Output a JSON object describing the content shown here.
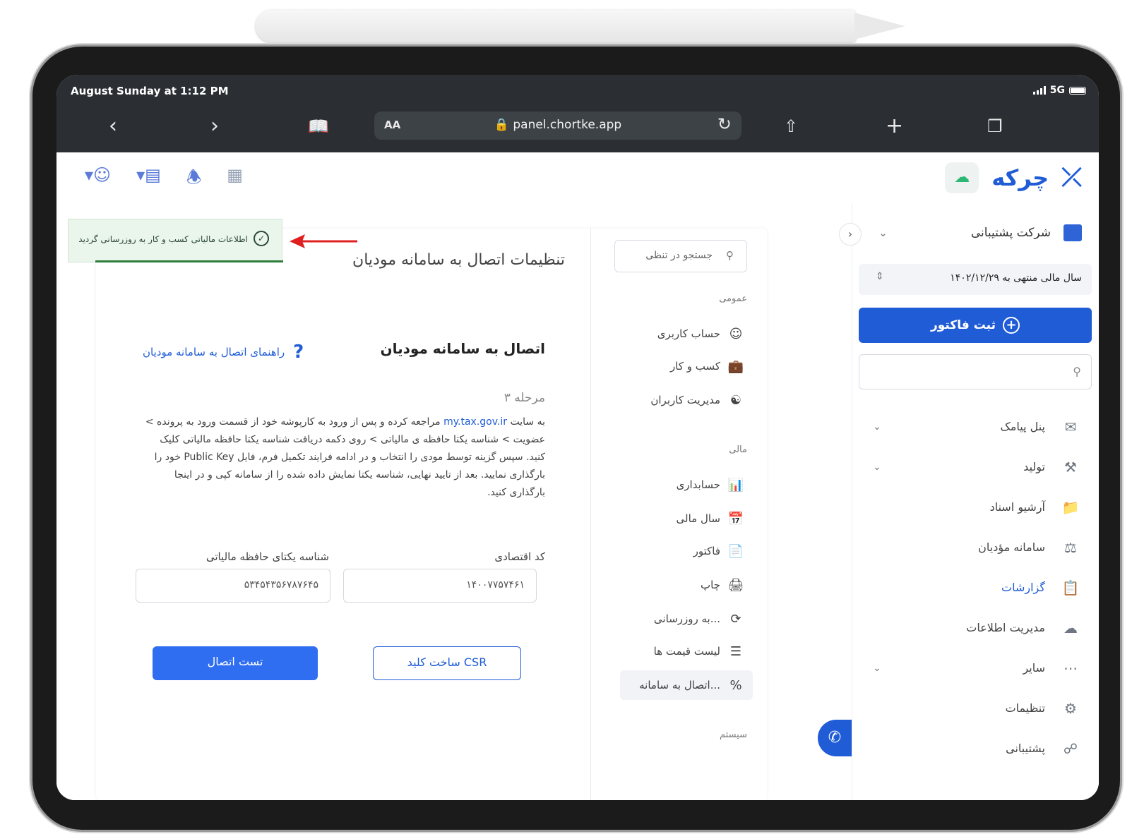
{
  "browser": {
    "status_time": "August Sunday at 1:12 PM",
    "network": "5G",
    "url_aa": "AA",
    "url": "panel.chortke.app"
  },
  "app": {
    "brand": "چرکه",
    "brand_color": "#1f5cd6"
  },
  "sidebar": {
    "company": "شرکت پشتیبانی",
    "fiscal_year": "سال مالی منتهی به ۱۴۰۲/۱۲/۲۹",
    "invoice_button": "ثبت فاکتور",
    "items": [
      {
        "label": "پنل پیامک",
        "icon": "sms-panel-icon",
        "chevron": true
      },
      {
        "label": "تولید",
        "icon": "production-icon",
        "chevron": true
      },
      {
        "label": "آرشیو اسناد",
        "icon": "folder-icon",
        "chevron": false
      },
      {
        "label": "سامانه مؤدیان",
        "icon": "gavel-icon",
        "chevron": false
      },
      {
        "label": "گزارشات",
        "icon": "reports-icon",
        "chevron": false,
        "active": true
      },
      {
        "label": "مدیریت اطلاعات",
        "icon": "data-settings-icon",
        "chevron": false
      },
      {
        "label": "سایر",
        "icon": "more-icon",
        "chevron": true
      },
      {
        "label": "تنظیمات",
        "icon": "gear-icon",
        "chevron": false
      },
      {
        "label": "پشتیبانی",
        "icon": "support-icon",
        "chevron": false
      }
    ]
  },
  "settings_nav": {
    "search_placeholder": "جستجو در تنظی",
    "section_general": "عمومی",
    "section_financial": "مالی",
    "section_system": "سیستم",
    "items": [
      {
        "label": "حساب کاربری",
        "icon": "user-icon"
      },
      {
        "label": "کسب و کار",
        "icon": "briefcase-icon"
      },
      {
        "label": "مدیریت کاربران",
        "icon": "users-icon"
      },
      {
        "label": "حسابداری",
        "icon": "accounting-icon"
      },
      {
        "label": "سال مالی",
        "icon": "calendar-icon"
      },
      {
        "label": "فاکتور",
        "icon": "invoice-icon"
      },
      {
        "label": "چاپ",
        "icon": "printer-icon"
      },
      {
        "label": "به روزرسانی...",
        "icon": "refresh-icon"
      },
      {
        "label": "لیست قیمت ها",
        "icon": "price-list-icon"
      },
      {
        "label": "اتصال به سامانه...",
        "icon": "tax-system-icon",
        "active": true
      }
    ]
  },
  "content": {
    "page_title": "تنظیمات اتصال به سامانه مودیان",
    "section_title": "اتصال به سامانه مودیان",
    "help_link": "راهنمای اتصال به سامانه مودیان",
    "step": "مرحله ۳",
    "desc_before_link": "به سایت ",
    "desc_link": "my.tax.gov.ir",
    "desc_after_link": " مراجعه کرده و پس از ورود به کارپوشه خود از قسمت ورود به پرونده > عضویت > شناسه یکتا حافظه ی مالیاتی > روی دکمه دریافت شناسه یکتا حافظه مالیاتی کلیک کنید. سپس گزینه توسط مودی را انتخاب و در ادامه فرایند تکمیل فرم، فایل Public Key خود را بارگذاری نمایید. بعد از تایید نهایی، شناسه یکتا نمایش داده شده را از سامانه کپی و در اینجا بارگذاری کنید.",
    "economic_code_label": "کد اقتصادی",
    "economic_code_value": "۱۴۰۰۷۷۵۷۴۶۱",
    "tax_memory_label": "شناسه یکتای حافظه مالیاتی",
    "tax_memory_value": "۵۳۴۵۴۳۵۶۷۸۷۶۴۵",
    "csr_button": "ساخت کلید CSR",
    "test_button": "تست اتصال"
  },
  "toast": {
    "message": "اطلاعات مالیاتی کسب و کار به روزرسانی گردید",
    "color": "#eaf5ec"
  },
  "annotation": {
    "arrow_color": "#e02020"
  }
}
